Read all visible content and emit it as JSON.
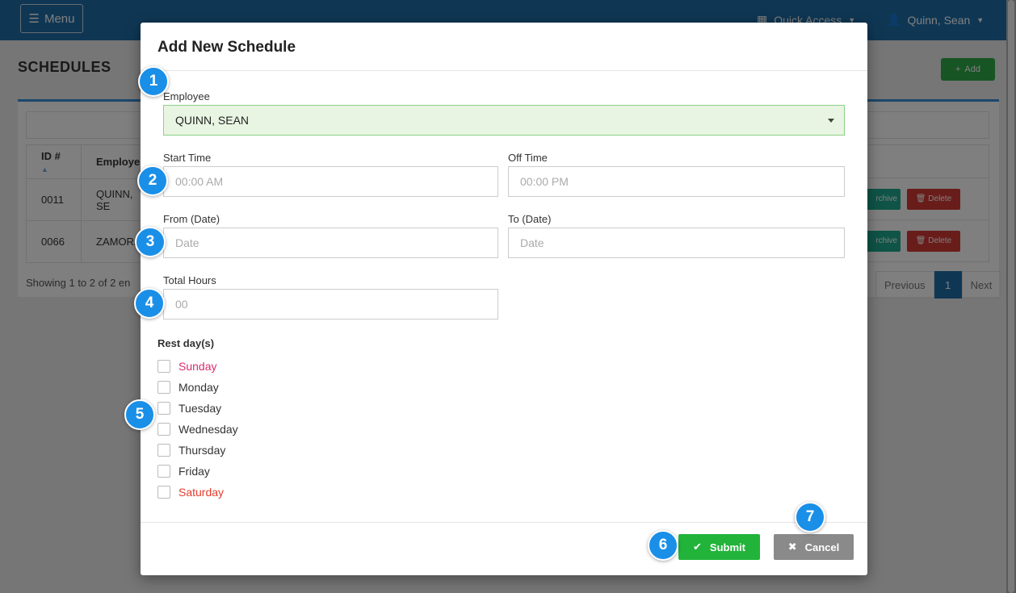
{
  "topbar": {
    "menu_label": "Menu",
    "quick_access_label": "Quick Access",
    "user_label": "Quinn, Sean"
  },
  "page": {
    "title": "SCHEDULES",
    "add_label": "Add"
  },
  "table": {
    "headers": [
      "ID #",
      "Employe"
    ],
    "rows": [
      {
        "id": "0011",
        "employee": "QUINN, SE"
      },
      {
        "id": "0066",
        "employee": "ZAMORA"
      }
    ],
    "archive_label": "rchive",
    "delete_label": "Delete",
    "showing_text": "Showing 1 to 2 of 2 en",
    "pager": {
      "previous": "Previous",
      "page": "1",
      "next": "Next"
    }
  },
  "modal": {
    "title": "Add New Schedule",
    "employee_label": "Employee",
    "employee_value": "QUINN, SEAN",
    "start_time_label": "Start Time",
    "start_time_placeholder": "00:00 AM",
    "off_time_label": "Off Time",
    "off_time_placeholder": "00:00 PM",
    "from_date_label": "From (Date)",
    "from_date_placeholder": "Date",
    "to_date_label": "To (Date)",
    "to_date_placeholder": "Date",
    "total_hours_label": "Total Hours",
    "total_hours_placeholder": "00",
    "rest_days_title": "Rest day(s)",
    "days": [
      "Sunday",
      "Monday",
      "Tuesday",
      "Wednesday",
      "Thursday",
      "Friday",
      "Saturday"
    ],
    "submit_label": "Submit",
    "cancel_label": "Cancel"
  },
  "callouts": [
    "1",
    "2",
    "3",
    "4",
    "5",
    "6",
    "7"
  ],
  "colors": {
    "topbar": "#1f6fa8",
    "submit": "#22b33b",
    "cancel": "#8a8a8a",
    "callout": "#1a8fe8",
    "sunday": "#d62d6e",
    "saturday": "#e43b2c",
    "employee_select_bg": "#e8f5e2"
  }
}
